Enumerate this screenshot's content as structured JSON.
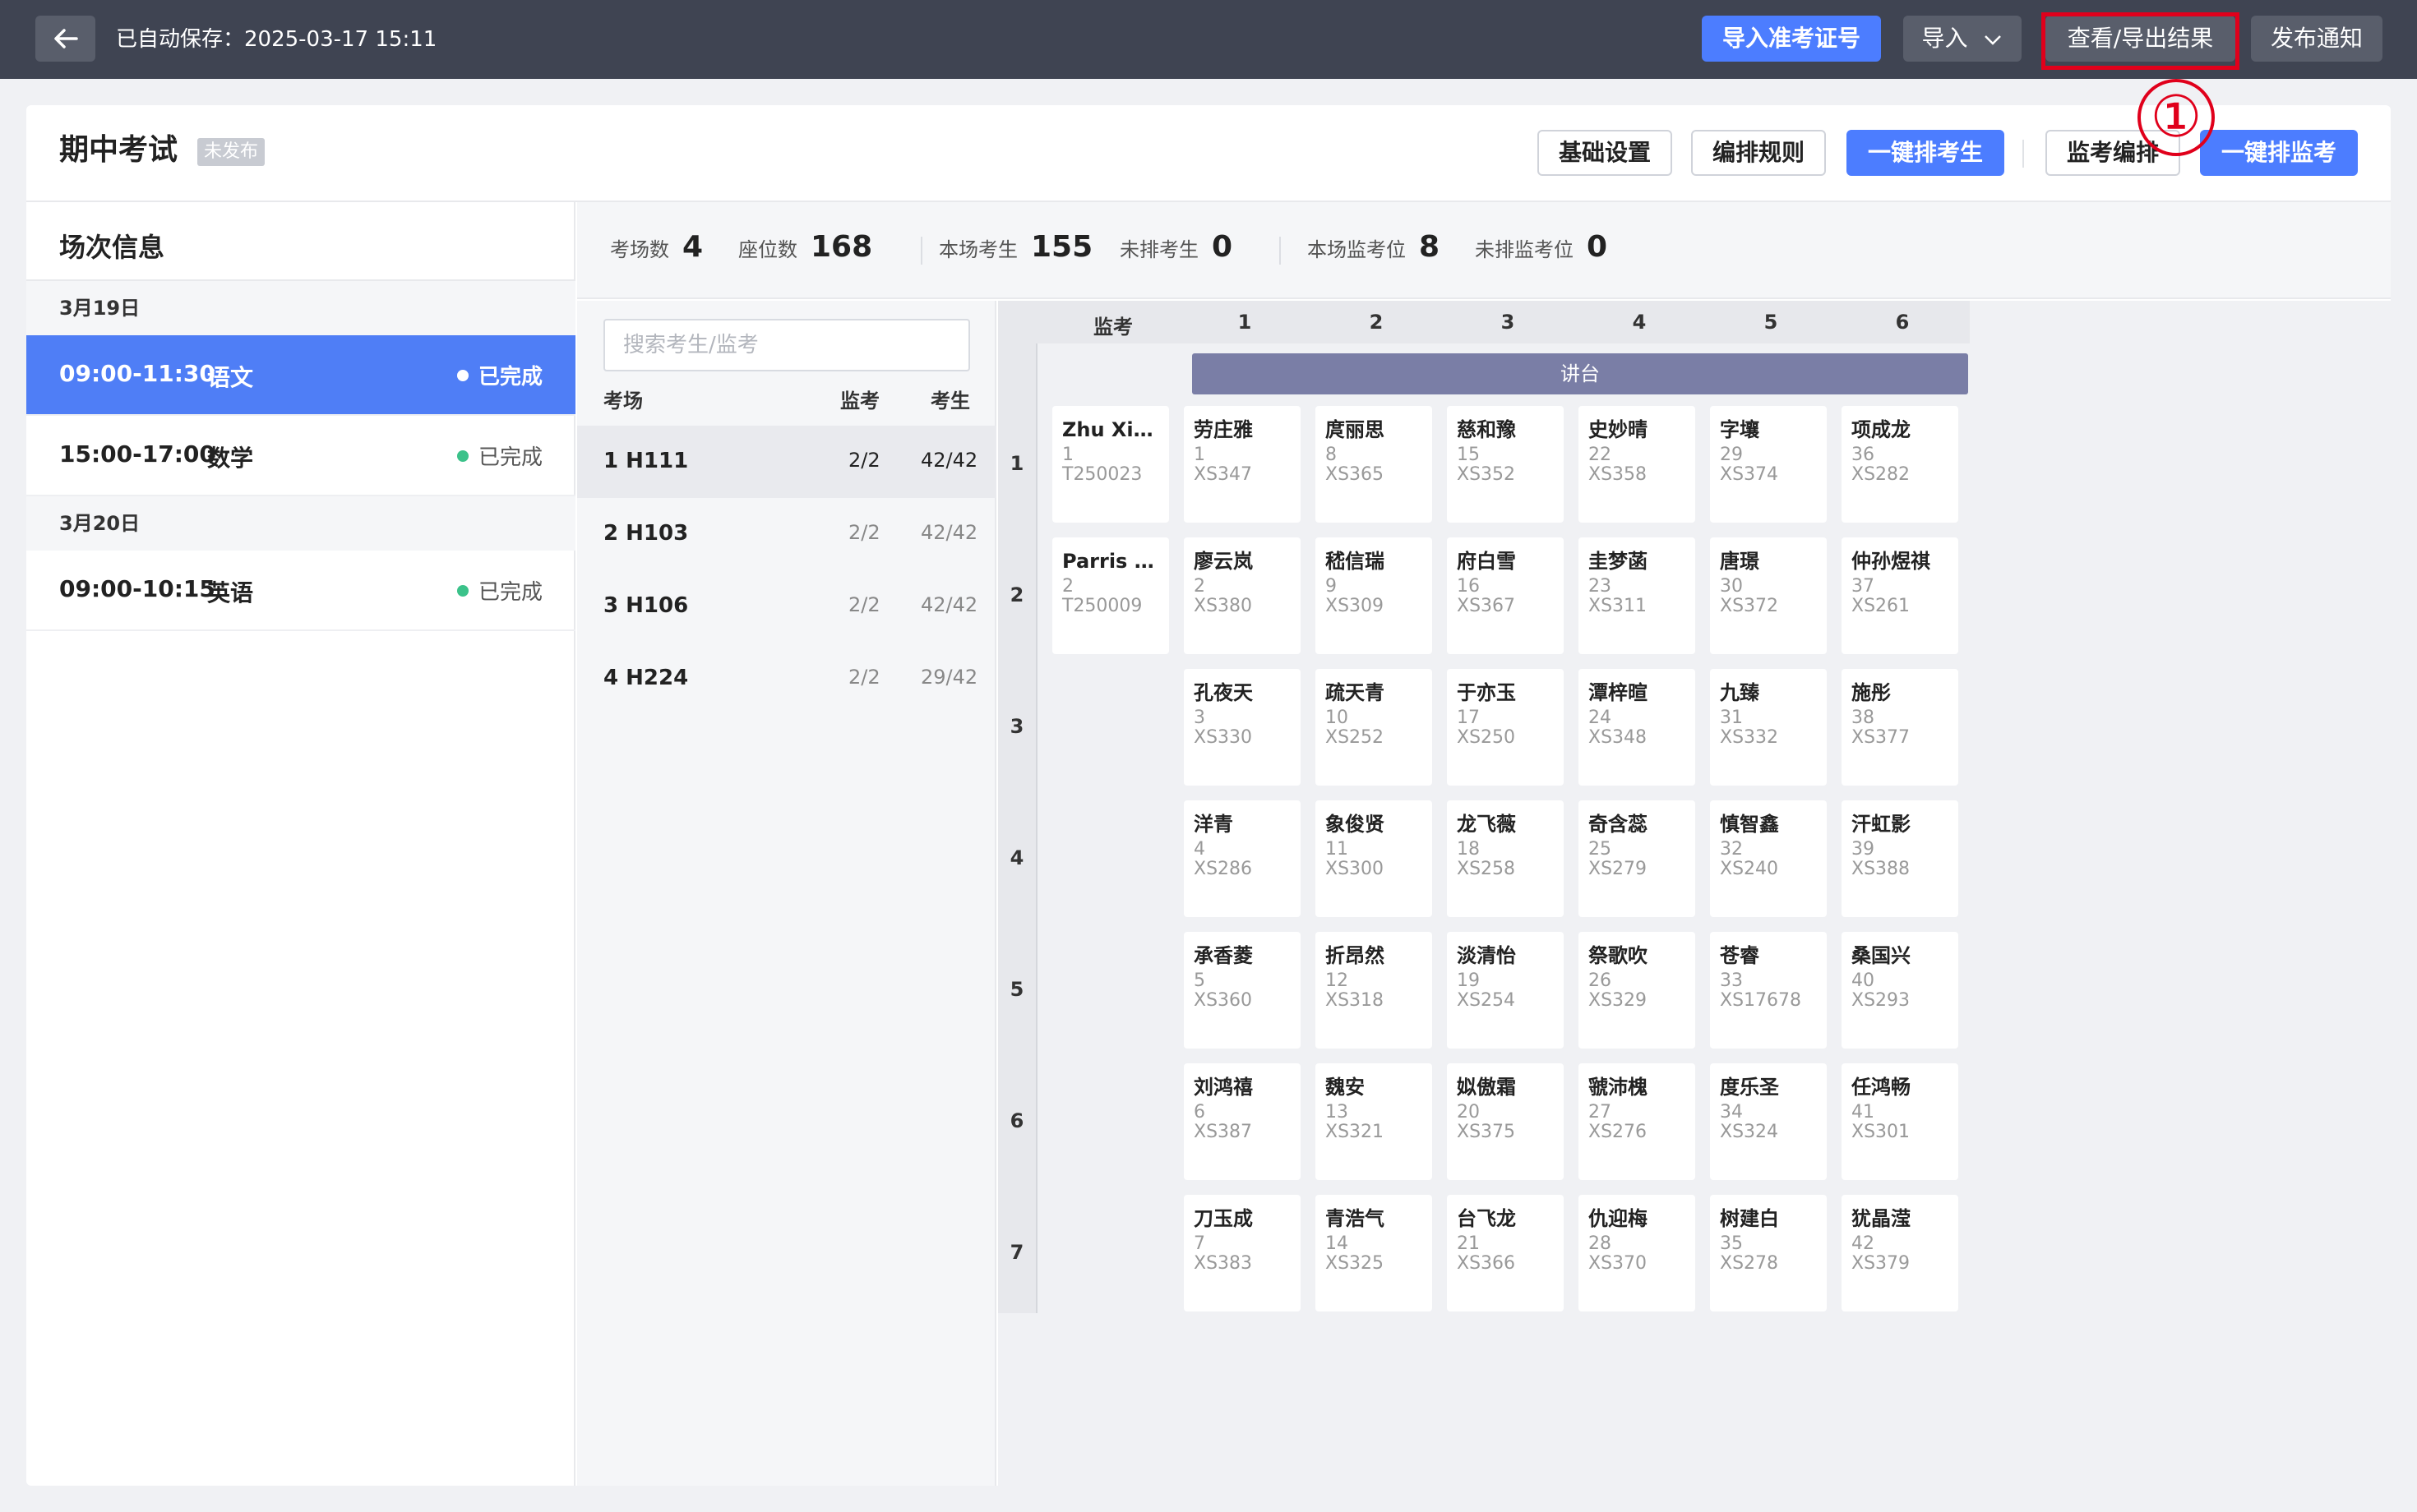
{
  "topbar": {
    "autosave": "已自动保存：2025-03-17 15:11",
    "import_admission_label": "导入准考证号",
    "import_label": "导入",
    "view_export_label": "查看/导出结果",
    "publish_label": "发布通知",
    "annotation_number": "①"
  },
  "exam": {
    "title": "期中考试",
    "status_badge": "未发布",
    "btn_basic": "基础设置",
    "btn_rules": "编排规则",
    "btn_auto_students": "一键排考生",
    "btn_invig_arrange": "监考编排",
    "btn_auto_invig": "一键排监考"
  },
  "sidebar": {
    "title": "场次信息",
    "groups": [
      {
        "date": "3月19日",
        "sessions": [
          {
            "time": "09:00-11:30",
            "subject": "语文",
            "status": "已完成"
          },
          {
            "time": "15:00-17:00",
            "subject": "数学",
            "status": "已完成"
          }
        ]
      },
      {
        "date": "3月20日",
        "sessions": [
          {
            "time": "09:00-10:15",
            "subject": "英语",
            "status": "已完成"
          }
        ]
      }
    ]
  },
  "stats": {
    "rooms_label": "考场数",
    "rooms_val": "4",
    "seats_label": "座位数",
    "seats_val": "168",
    "students_label": "本场考生",
    "students_val": "155",
    "unassigned_label": "未排考生",
    "unassigned_val": "0",
    "invig_label": "本场监考位",
    "invig_val": "8",
    "unassigned_invig_label": "未排监考位",
    "unassigned_invig_val": "0"
  },
  "rooms": {
    "search_placeholder": "搜索考生/监考",
    "col_room": "考场",
    "col_proctor": "监考",
    "col_student": "考生",
    "list": [
      {
        "name": "1 H111",
        "proctor": "2/2",
        "student": "42/42"
      },
      {
        "name": "2 H103",
        "proctor": "2/2",
        "student": "42/42"
      },
      {
        "name": "3 H106",
        "proctor": "2/2",
        "student": "42/42"
      },
      {
        "name": "4 H224",
        "proctor": "2/2",
        "student": "29/42"
      }
    ]
  },
  "grid": {
    "proctor_col": "监考",
    "cols": [
      "1",
      "2",
      "3",
      "4",
      "5",
      "6"
    ],
    "rows": [
      "1",
      "2",
      "3",
      "4",
      "5",
      "6",
      "7"
    ],
    "podium": "讲台",
    "proctors": [
      {
        "name": "Zhu Xia...",
        "no": "1",
        "id": "T250023"
      },
      {
        "name": "Parris K...",
        "no": "2",
        "id": "T250009"
      }
    ],
    "seats": [
      [
        {
          "name": "劳庄雅",
          "no": "1",
          "id": "XS347"
        },
        {
          "name": "庹丽思",
          "no": "8",
          "id": "XS365"
        },
        {
          "name": "慈和豫",
          "no": "15",
          "id": "XS352"
        },
        {
          "name": "史妙晴",
          "no": "22",
          "id": "XS358"
        },
        {
          "name": "字壤",
          "no": "29",
          "id": "XS374"
        },
        {
          "name": "项成龙",
          "no": "36",
          "id": "XS282"
        }
      ],
      [
        {
          "name": "廖云岚",
          "no": "2",
          "id": "XS380"
        },
        {
          "name": "嵇信瑞",
          "no": "9",
          "id": "XS309"
        },
        {
          "name": "府白雪",
          "no": "16",
          "id": "XS367"
        },
        {
          "name": "圭梦菡",
          "no": "23",
          "id": "XS311"
        },
        {
          "name": "唐璟",
          "no": "30",
          "id": "XS372"
        },
        {
          "name": "仲孙煜祺",
          "no": "37",
          "id": "XS261"
        }
      ],
      [
        {
          "name": "孔夜天",
          "no": "3",
          "id": "XS330"
        },
        {
          "name": "疏天青",
          "no": "10",
          "id": "XS252"
        },
        {
          "name": "于亦玉",
          "no": "17",
          "id": "XS250"
        },
        {
          "name": "潭梓暄",
          "no": "24",
          "id": "XS348"
        },
        {
          "name": "九臻",
          "no": "31",
          "id": "XS332"
        },
        {
          "name": "施彤",
          "no": "38",
          "id": "XS377"
        }
      ],
      [
        {
          "name": "洋青",
          "no": "4",
          "id": "XS286"
        },
        {
          "name": "象俊贤",
          "no": "11",
          "id": "XS300"
        },
        {
          "name": "龙飞薇",
          "no": "18",
          "id": "XS258"
        },
        {
          "name": "奇含蕊",
          "no": "25",
          "id": "XS279"
        },
        {
          "name": "慎智鑫",
          "no": "32",
          "id": "XS240"
        },
        {
          "name": "汗虹影",
          "no": "39",
          "id": "XS388"
        }
      ],
      [
        {
          "name": "承香菱",
          "no": "5",
          "id": "XS360"
        },
        {
          "name": "折昂然",
          "no": "12",
          "id": "XS318"
        },
        {
          "name": "淡清怡",
          "no": "19",
          "id": "XS254"
        },
        {
          "name": "祭歌吹",
          "no": "26",
          "id": "XS329"
        },
        {
          "name": "苍睿",
          "no": "33",
          "id": "XS17678"
        },
        {
          "name": "桑国兴",
          "no": "40",
          "id": "XS293"
        }
      ],
      [
        {
          "name": "刘鸿禧",
          "no": "6",
          "id": "XS387"
        },
        {
          "name": "魏安",
          "no": "13",
          "id": "XS321"
        },
        {
          "name": "姒傲霜",
          "no": "20",
          "id": "XS375"
        },
        {
          "name": "虢沛槐",
          "no": "27",
          "id": "XS276"
        },
        {
          "name": "度乐圣",
          "no": "34",
          "id": "XS324"
        },
        {
          "name": "任鸿畅",
          "no": "41",
          "id": "XS301"
        }
      ],
      [
        {
          "name": "刀玉成",
          "no": "7",
          "id": "XS383"
        },
        {
          "name": "青浩气",
          "no": "14",
          "id": "XS325"
        },
        {
          "name": "台飞龙",
          "no": "21",
          "id": "XS366"
        },
        {
          "name": "仇迎梅",
          "no": "28",
          "id": "XS370"
        },
        {
          "name": "树建白",
          "no": "35",
          "id": "XS278"
        },
        {
          "name": "犹晶滢",
          "no": "42",
          "id": "XS379"
        }
      ]
    ]
  },
  "colors": {
    "primary": "#4c7dff",
    "topbar": "#3f4452",
    "highlight": "#e0001b",
    "success": "#3bc28a",
    "podium": "#7a7ea6"
  }
}
